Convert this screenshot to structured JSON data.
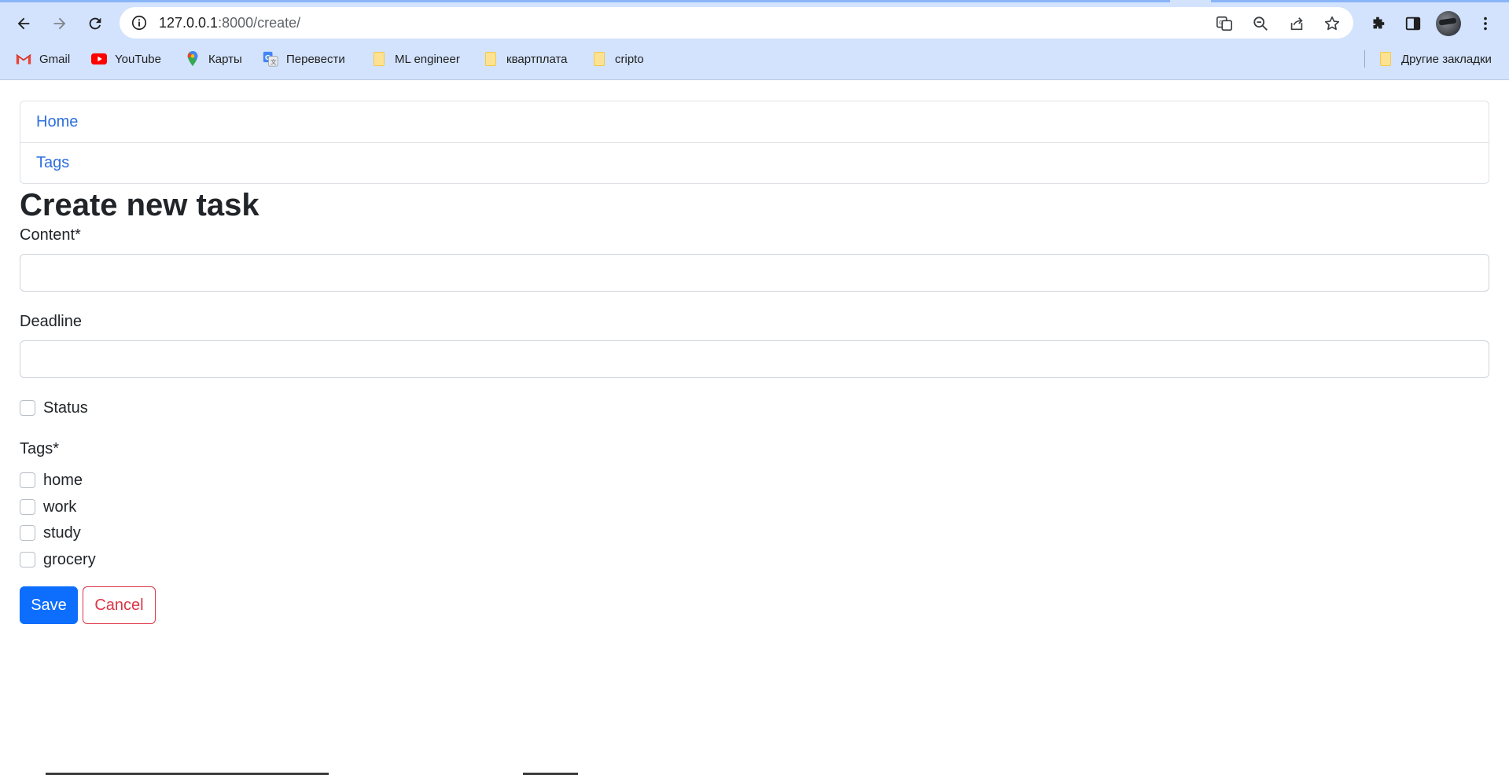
{
  "browser": {
    "url_host": "127.0.0.1",
    "url_path": ":8000/create/",
    "bookmarks": [
      {
        "label": "Gmail",
        "icon": "gmail-icon"
      },
      {
        "label": "YouTube",
        "icon": "youtube-icon"
      },
      {
        "label": "Карты",
        "icon": "maps-icon"
      },
      {
        "label": "Перевести",
        "icon": "translate-icon"
      },
      {
        "label": "ML engineer",
        "icon": "folder-icon"
      },
      {
        "label": "квартплата",
        "icon": "folder-icon"
      },
      {
        "label": "cripto",
        "icon": "folder-icon"
      }
    ],
    "other_bookmarks": "Другие закладки"
  },
  "nav": {
    "items": [
      {
        "label": "Home"
      },
      {
        "label": "Tags"
      }
    ]
  },
  "form": {
    "title": "Create new task",
    "content_label": "Content*",
    "content_value": "",
    "deadline_label": "Deadline",
    "deadline_value": "",
    "status_label": "Status",
    "tags_label": "Tags*",
    "tags": [
      {
        "label": "home"
      },
      {
        "label": "work"
      },
      {
        "label": "study"
      },
      {
        "label": "grocery"
      }
    ],
    "save_label": "Save",
    "cancel_label": "Cancel"
  },
  "colors": {
    "primary": "#0d6efd",
    "danger": "#dc3545",
    "link": "#2f6fde",
    "chrome_bg": "#d3e3fd"
  }
}
